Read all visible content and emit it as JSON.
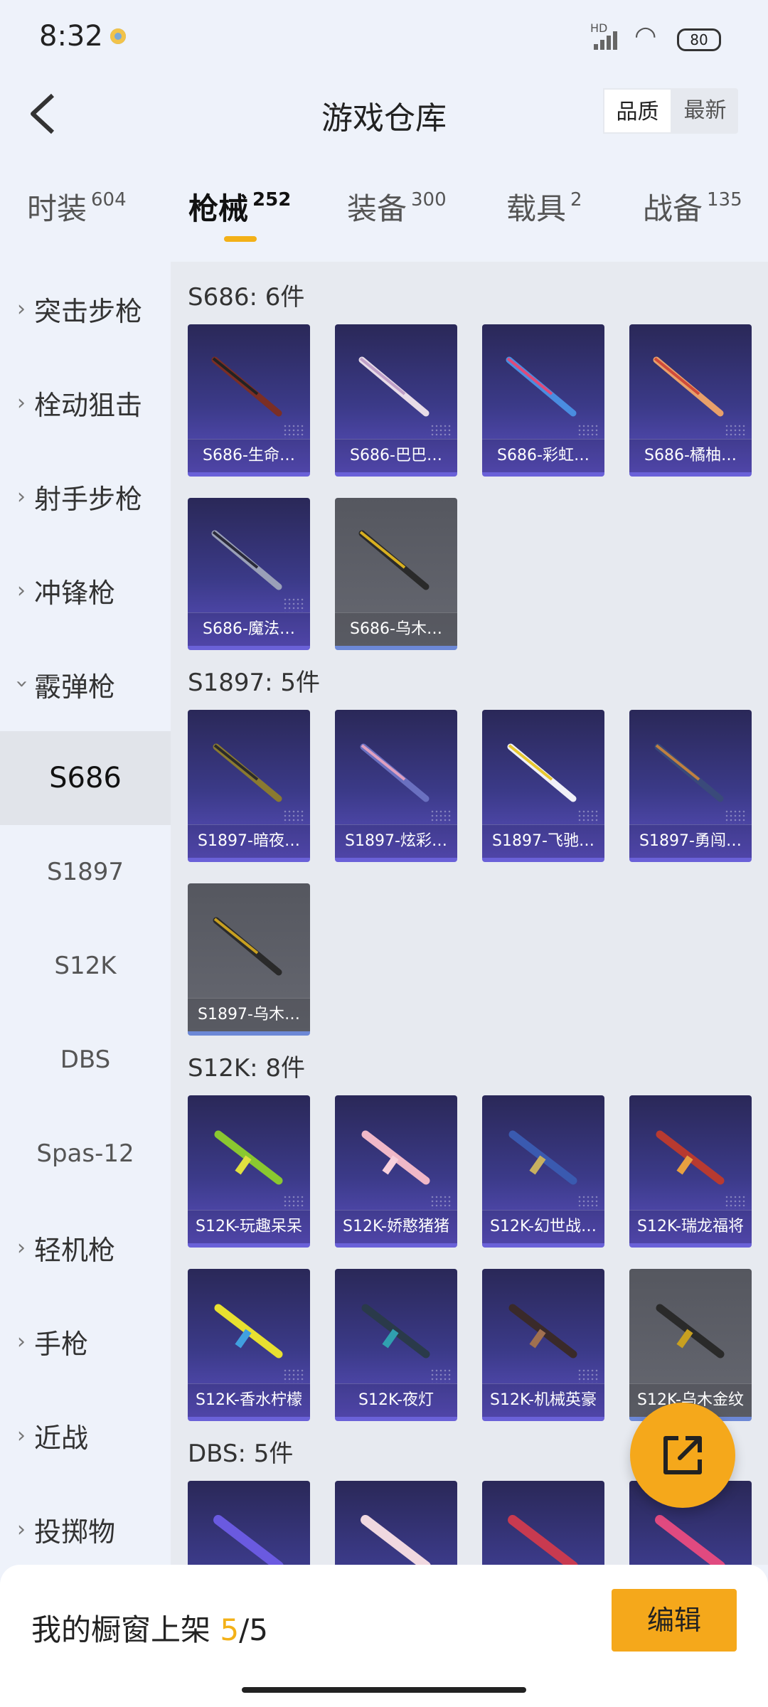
{
  "status": {
    "time": "8:32",
    "signal": "HD",
    "battery": "80"
  },
  "header": {
    "title": "游戏仓库",
    "sort": [
      "品质",
      "最新"
    ]
  },
  "tabs": [
    {
      "label": "时装",
      "count": "604"
    },
    {
      "label": "枪械",
      "count": "252"
    },
    {
      "label": "装备",
      "count": "300"
    },
    {
      "label": "载具",
      "count": "2"
    },
    {
      "label": "战备",
      "count": "135"
    }
  ],
  "sidebar": {
    "groups": [
      "突击步枪",
      "栓动狙击",
      "射手步枪",
      "冲锋枪",
      "霰弹枪"
    ],
    "subs": [
      "S686",
      "S1897",
      "S12K",
      "DBS",
      "Spas-12"
    ],
    "groups2": [
      "轻机枪",
      "手枪",
      "近战",
      "投掷物"
    ]
  },
  "sections": [
    {
      "title": "S686: 6件",
      "items": [
        "S686-生命…",
        "S686-巴巴…",
        "S686-彩虹…",
        "S686-橘柚…",
        "S686-魔法…",
        "S686-乌木…"
      ]
    },
    {
      "title": "S1897: 5件",
      "items": [
        "S1897-暗夜…",
        "S1897-炫彩…",
        "S1897-飞驰…",
        "S1897-勇闯…",
        "S1897-乌木…"
      ]
    },
    {
      "title": "S12K: 8件",
      "items": [
        "S12K-玩趣呆呆",
        "S12K-娇憨猪猪",
        "S12K-幻世战…",
        "S12K-瑞龙福将",
        "S12K-香水柠檬",
        "S12K-夜灯",
        "S12K-机械英豪",
        "S12K-乌木金纹"
      ]
    },
    {
      "title": "DBS: 5件"
    }
  ],
  "bottom": {
    "label": "我的橱窗上架",
    "current": "5",
    "total": "/5",
    "edit": "编辑"
  }
}
